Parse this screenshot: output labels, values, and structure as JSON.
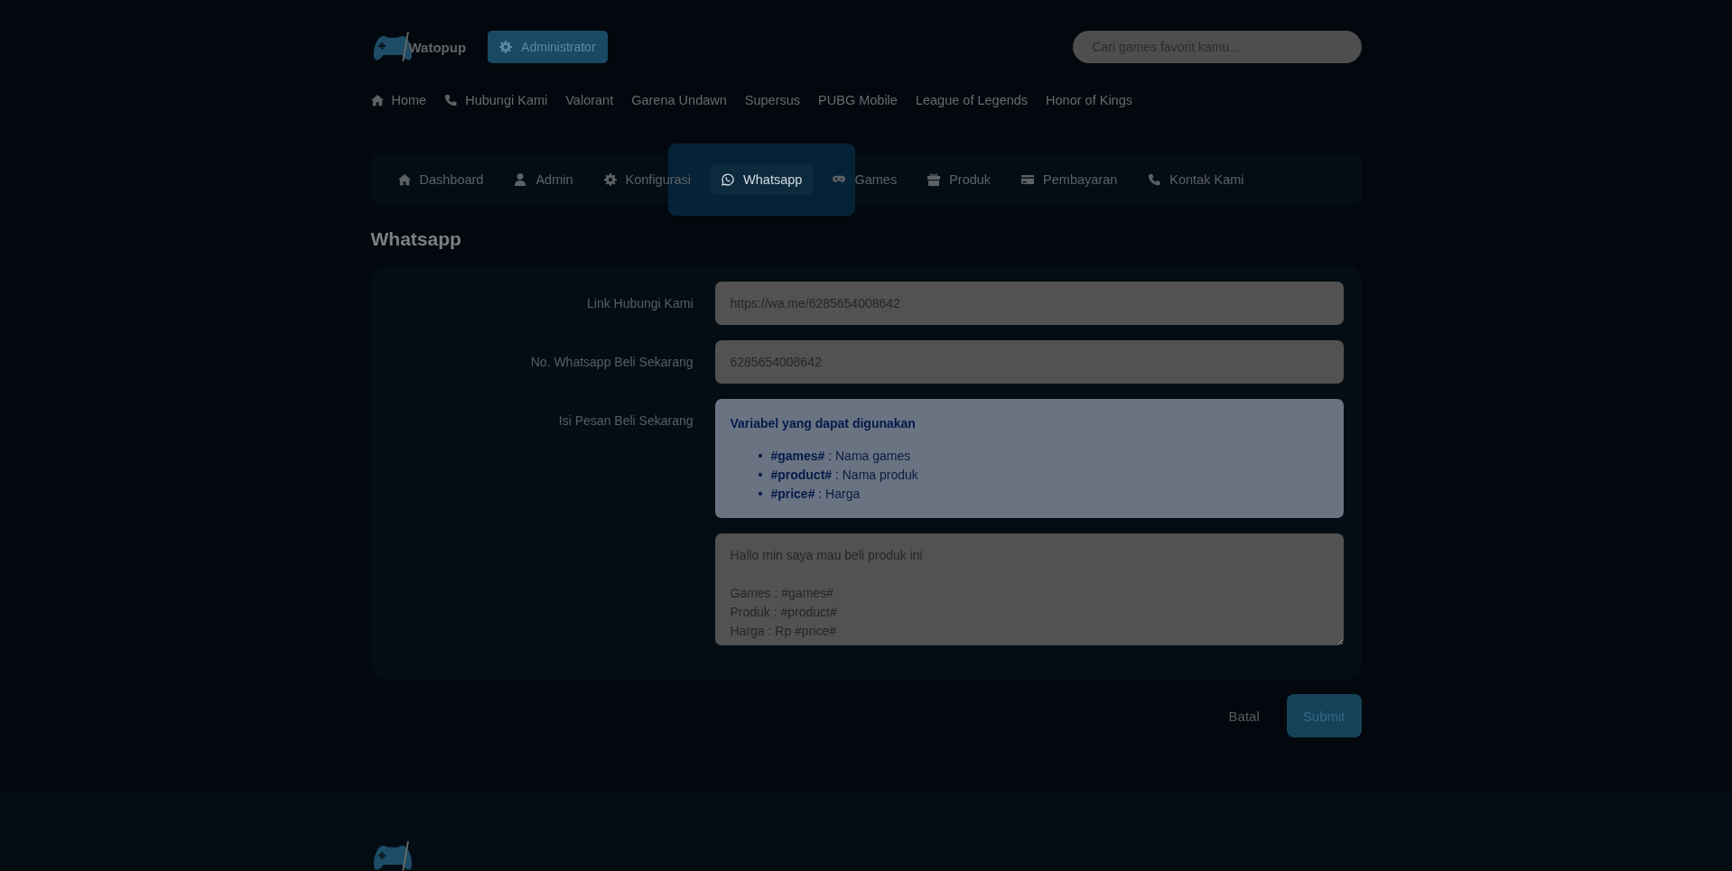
{
  "header": {
    "logo_text": "Watopup",
    "role_button": "Administrator",
    "search": {
      "placeholder": "Cari games favorit kamu..."
    }
  },
  "nav": [
    {
      "label": "Home"
    },
    {
      "label": "Hubungi Kami"
    },
    {
      "label": "Valorant"
    },
    {
      "label": "Garena Undawn"
    },
    {
      "label": "Supersus"
    },
    {
      "label": "PUBG Mobile"
    },
    {
      "label": "League of Legends"
    },
    {
      "label": "Honor of Kings"
    }
  ],
  "tabs": [
    {
      "label": "Dashboard",
      "selected": false
    },
    {
      "label": "Admin",
      "selected": false
    },
    {
      "label": "Konfigurasi",
      "selected": false
    },
    {
      "label": "Whatsapp",
      "selected": true
    },
    {
      "label": "Games",
      "selected": false
    },
    {
      "label": "Produk",
      "selected": false
    },
    {
      "label": "Pembayaran",
      "selected": false
    },
    {
      "label": "Kontak Kami",
      "selected": false
    }
  ],
  "page_title": "Whatsapp",
  "form": {
    "fields": [
      {
        "kind": "input",
        "label": "Link Hubungi Kami",
        "value": "https://wa.me/6285654008642"
      },
      {
        "kind": "input",
        "label": "No. Whatsapp Beli Sekarang",
        "value": "6285654008642"
      },
      {
        "kind": "message",
        "label": "Isi Pesan Beli Sekarang",
        "info": {
          "title": "Variabel yang dapat digunakan",
          "items": [
            {
              "bullet": "•",
              "text": "**#games#** : Nama games"
            },
            {
              "bullet": "•",
              "text": "**#product#** : Nama produk"
            },
            {
              "bullet": "•",
              "text": "**#price#** : Harga"
            }
          ]
        },
        "value": "Hallo min saya mau beli produk ini\n\nGames : #games#\nProduk : #product#\nHarga : Rp #price#"
      }
    ]
  },
  "actions": {
    "cancel": "Batal",
    "submit": "Submit"
  }
}
